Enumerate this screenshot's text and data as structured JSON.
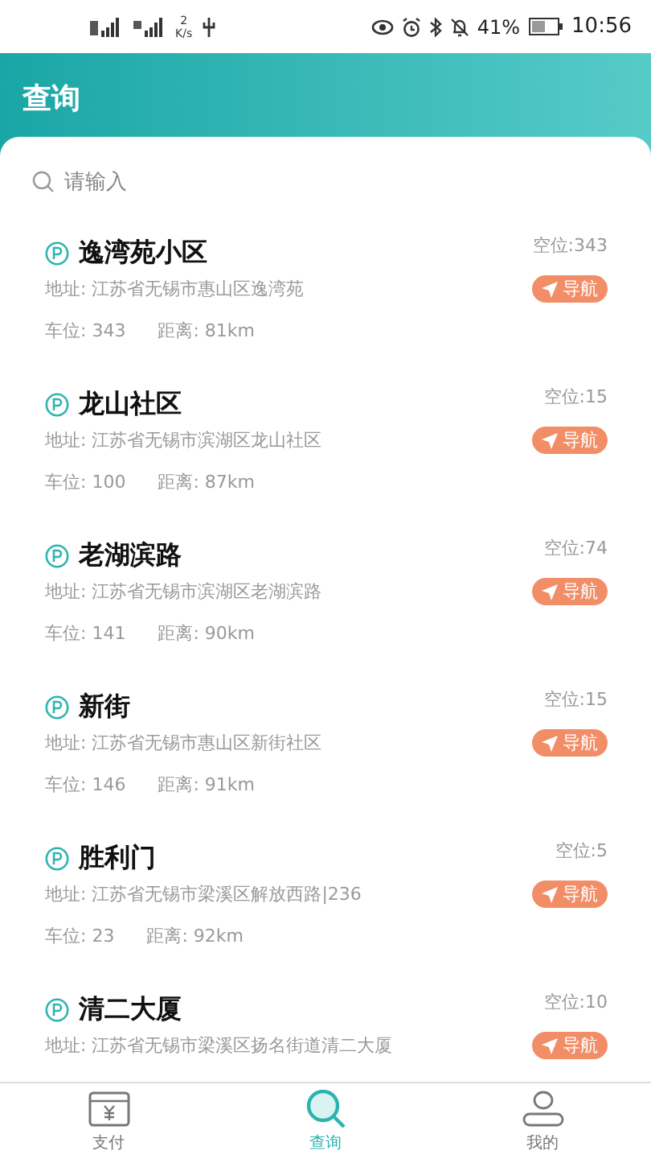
{
  "status_bar": {
    "speed_value": "2",
    "speed_unit": "K/s",
    "battery": "41%",
    "time": "10:56"
  },
  "header": {
    "title": "查询"
  },
  "search": {
    "placeholder": "请输入"
  },
  "parkings": [
    {
      "name": "逸湾苑小区",
      "free": "空位:343",
      "address": "地址: 江苏省无锡市惠山区逸湾苑",
      "nav": "导航",
      "spots": "车位: 343",
      "distance": "距离: 81km"
    },
    {
      "name": "龙山社区",
      "free": "空位:15",
      "address": "地址: 江苏省无锡市滨湖区龙山社区",
      "nav": "导航",
      "spots": "车位: 100",
      "distance": "距离: 87km"
    },
    {
      "name": "老湖滨路",
      "free": "空位:74",
      "address": "地址: 江苏省无锡市滨湖区老湖滨路",
      "nav": "导航",
      "spots": "车位: 141",
      "distance": "距离: 90km"
    },
    {
      "name": "新街",
      "free": "空位:15",
      "address": "地址: 江苏省无锡市惠山区新街社区",
      "nav": "导航",
      "spots": "车位: 146",
      "distance": "距离: 91km"
    },
    {
      "name": "胜利门",
      "free": "空位:5",
      "address": "地址: 江苏省无锡市梁溪区解放西路|236",
      "nav": "导航",
      "spots": "车位: 23",
      "distance": "距离: 92km"
    },
    {
      "name": "清二大厦",
      "free": "空位:10",
      "address": "地址: 江苏省无锡市梁溪区扬名街道清二大厦",
      "nav": "导航"
    }
  ],
  "tabs": [
    {
      "kind": "pay",
      "label": "支付",
      "selected": false
    },
    {
      "kind": "search",
      "label": "查询",
      "selected": true
    },
    {
      "kind": "profile",
      "label": "我的",
      "selected": false
    }
  ]
}
